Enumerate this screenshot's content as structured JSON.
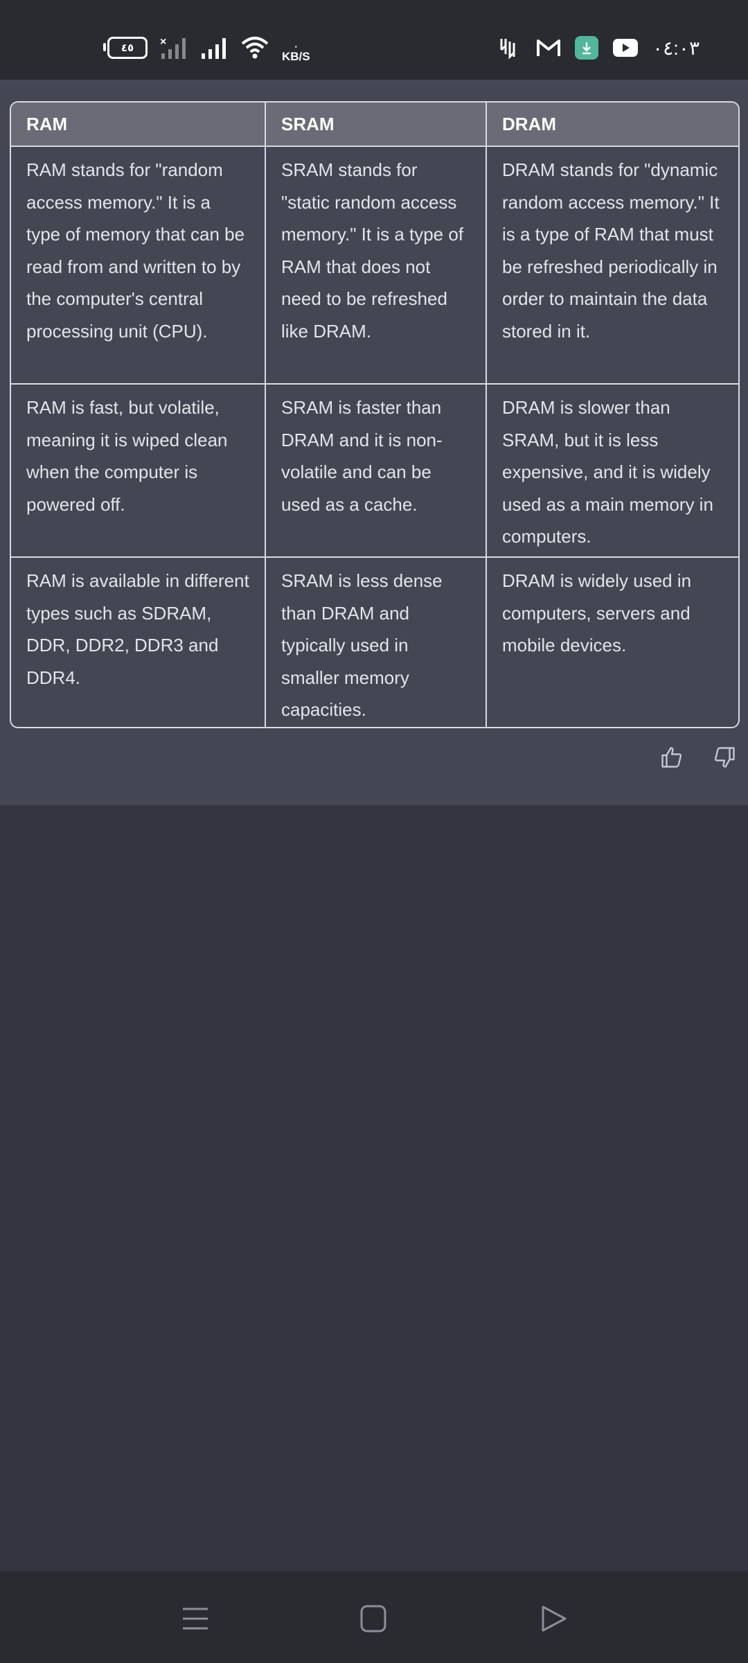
{
  "status_bar": {
    "battery": "٤٥",
    "net_speed_value": "٠",
    "net_speed_unit": "KB/S",
    "time": "٠٤:٠٣",
    "icons": [
      "battery-icon",
      "no-signal-icon",
      "signal-icon",
      "wifi-icon",
      "stock-icon",
      "gmail-icon",
      "download-icon",
      "youtube-icon"
    ]
  },
  "table": {
    "headers": [
      "RAM",
      "SRAM",
      "DRAM"
    ],
    "rows": [
      [
        "RAM stands for \"random access memory.\" It is a type of memory that can be read from and written to by the computer's central processing unit (CPU).",
        "SRAM stands for \"static random access memory.\" It is a type of RAM that does not need to be refreshed like DRAM.",
        "DRAM stands for \"dynamic random access memory.\" It is a type of RAM that must be refreshed periodically in order to maintain the data stored in it."
      ],
      [
        "RAM is fast, but volatile, meaning it is wiped clean when the computer is powered off.",
        "SRAM is faster than DRAM and it is non-volatile and can be used as a cache.",
        "DRAM is slower than SRAM, but it is less expensive, and it is widely used as a main memory in computers."
      ],
      [
        "RAM is available in different types such as SDRAM, DDR, DDR2, DDR3 and DDR4.",
        "SRAM is less dense than DRAM and typically used in smaller memory capacities.",
        "DRAM is widely used in computers, servers and mobile devices."
      ]
    ]
  },
  "feedback": {
    "icons": [
      "thumbs-up-icon",
      "thumbs-down-icon"
    ]
  },
  "nav_bar": {
    "icons": [
      "menu-icon",
      "home-icon",
      "back-icon"
    ]
  },
  "colors": {
    "background": "#343541",
    "message_bg": "#444654",
    "header_bg": "#6b6b78",
    "border": "#d9d9e3",
    "bar_bg": "#2a2a31",
    "download_green": "#4fb89a"
  }
}
